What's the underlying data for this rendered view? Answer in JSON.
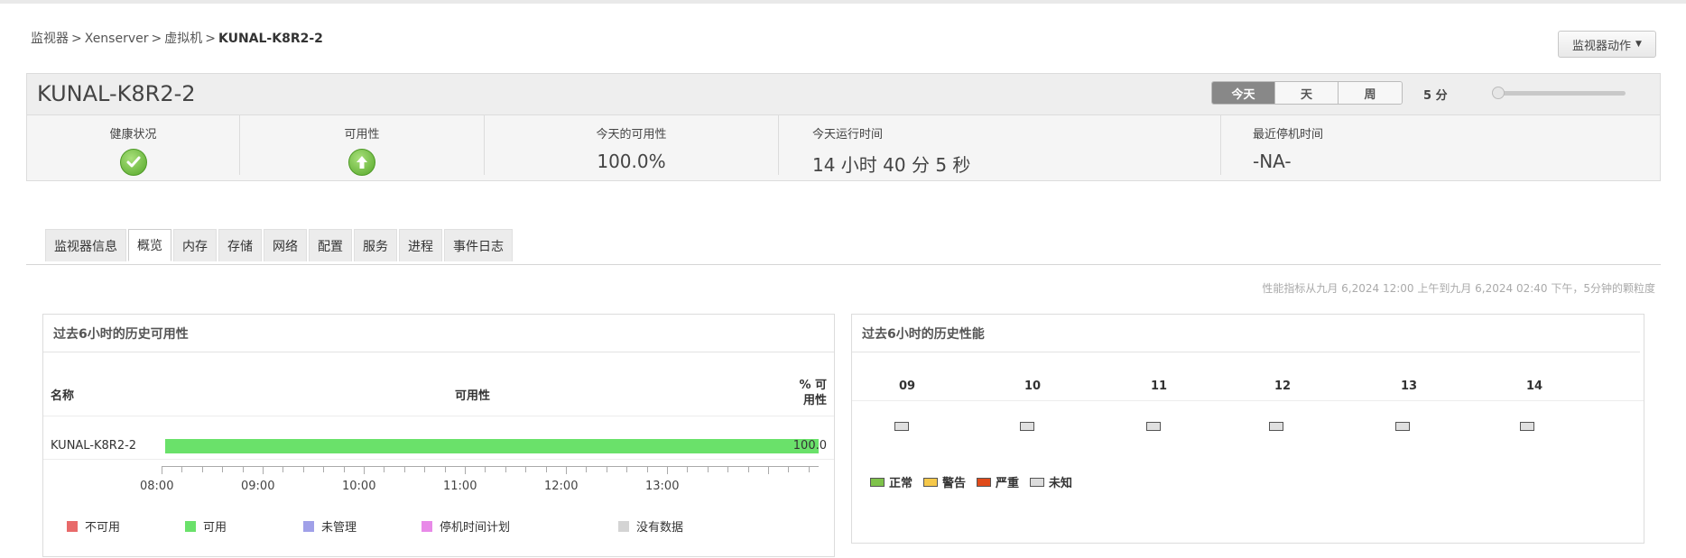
{
  "breadcrumb": {
    "item1": "监视器",
    "item2": "Xenserver",
    "item3": "虚拟机",
    "current": "KUNAL-K8R2-2",
    "separator": ">"
  },
  "actions": {
    "monitor_actions_label": "监视器动作"
  },
  "summary": {
    "title": "KUNAL-K8R2-2",
    "periods": [
      "今天",
      "天",
      "周"
    ],
    "active_period": "今天",
    "interval": "5 分",
    "health_label": "健康状况",
    "availability_label": "可用性",
    "today_availability_label": "今天的可用性",
    "today_availability_value": "100.0%",
    "today_uptime_label": "今天运行时间",
    "today_uptime_value": "14 小时 40 分 5 秒",
    "last_downtime_label": "最近停机时间",
    "last_downtime_value": "-NA-"
  },
  "tabs": [
    "监视器信息",
    "概览",
    "内存",
    "存储",
    "网络",
    "配置",
    "服务",
    "进程",
    "事件日志"
  ],
  "active_tab": "概览",
  "perf_note": "性能指标从九月 6,2024 12:00 上午到九月 6,2024 02:40 下午，5分钟的颗粒度",
  "availability_panel": {
    "title": "过去6小时的历史可用性",
    "col_name": "名称",
    "col_availability": "可用性",
    "col_pct_line1": "% 可",
    "col_pct_line2": "用性",
    "row": {
      "name": "KUNAL-K8R2-2",
      "available_fraction": 1.0,
      "pct": "100.0"
    },
    "time_labels": [
      "08:00",
      "09:00",
      "10:00",
      "11:00",
      "12:00",
      "13:00"
    ],
    "legend": [
      {
        "label": "不可用",
        "color": "#e86a6a"
      },
      {
        "label": "可用",
        "color": "#6ae16a"
      },
      {
        "label": "未管理",
        "color": "#a0a0e8"
      },
      {
        "label": "停机时间计划",
        "color": "#e88ae8"
      },
      {
        "label": "没有数据",
        "color": "#d4d4d4"
      }
    ]
  },
  "performance_panel": {
    "title": "过去6小时的历史性能",
    "hours": [
      "09",
      "10",
      "11",
      "12",
      "13",
      "14"
    ],
    "cell_color": "#e0e0e0",
    "legend": [
      {
        "label": "正常",
        "color": "#7ec24a"
      },
      {
        "label": "警告",
        "color": "#f5c84a"
      },
      {
        "label": "严重",
        "color": "#e04a1a"
      },
      {
        "label": "未知",
        "color": "#dcdcdc"
      }
    ]
  }
}
